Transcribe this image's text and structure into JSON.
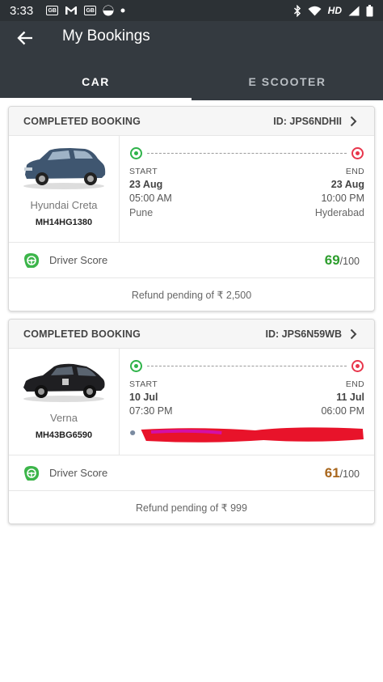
{
  "status_bar": {
    "time": "3:33",
    "left_icons": [
      "gsm-box-icon",
      "gmail-icon",
      "gsm-box-icon",
      "pinwheel-icon",
      "dot-icon"
    ],
    "gsm_label": "GB",
    "hd": "HD",
    "right_icons": [
      "bluetooth-icon",
      "wifi-icon",
      "signal-icon",
      "battery-icon"
    ]
  },
  "header": {
    "title": "My Bookings",
    "back_icon": "arrow-left-icon"
  },
  "tabs": [
    {
      "label": "CAR",
      "active": true
    },
    {
      "label": "E SCOOTER",
      "active": false
    }
  ],
  "bookings": [
    {
      "status": "COMPLETED BOOKING",
      "id": "ID: JPS6NDHII",
      "car_name": "Hyundai Creta",
      "plate": "MH14HG1380",
      "car_color": "#3f5670",
      "start_label": "START",
      "end_label": "END",
      "start_date": "23 Aug",
      "end_date": "23 Aug",
      "start_time": "05:00 AM",
      "end_time": "10:00 PM",
      "start_city": "Pune",
      "end_city": "Hyderabad",
      "score_label": "Driver Score",
      "score": "69",
      "score_max": "/100",
      "score_color": "#2e9e2e",
      "refund": "Refund pending of ₹ 2,500"
    },
    {
      "status": "COMPLETED BOOKING",
      "id": "ID: JPS6N59WB",
      "car_name": "Verna",
      "plate": "MH43BG6590",
      "car_color": "#1f1f22",
      "start_label": "START",
      "end_label": "END",
      "start_date": "10 Jul",
      "end_date": "11 Jul",
      "start_time": "07:30 PM",
      "end_time": "06:00 PM",
      "score_label": "Driver Score",
      "score": "61",
      "score_max": "/100",
      "score_color": "#a8661c",
      "refund": "Refund pending of ₹ 999"
    }
  ],
  "colors": {
    "app_bar": "#343a40",
    "start_pin": "#2fb34a",
    "end_pin": "#e8364c",
    "score_icon": "#3cb54a",
    "redaction": "#e8132a"
  }
}
